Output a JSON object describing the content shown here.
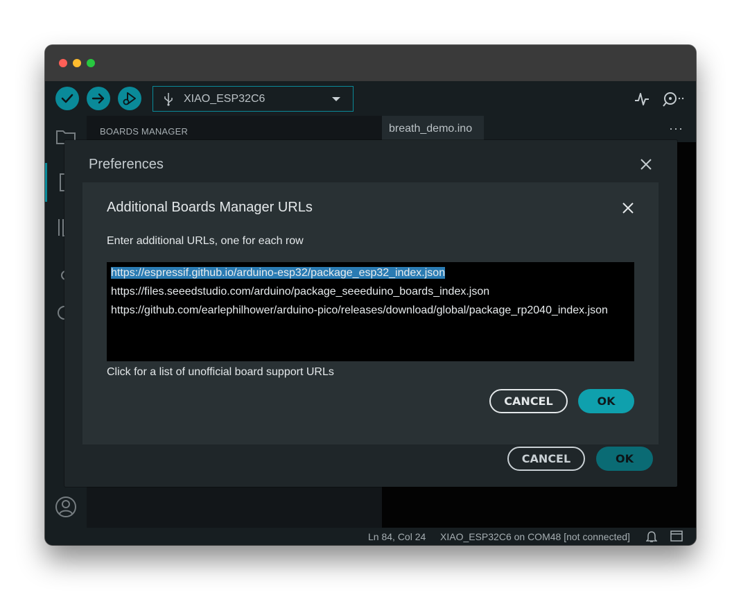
{
  "toolbar": {
    "selected_board": "XIAO_ESP32C6",
    "verify_icon": "check-icon",
    "upload_icon": "arrow-right-icon",
    "debug_icon": "debug-icon",
    "accent": "#0a8a99"
  },
  "sidebar": {
    "title": "BOARDS MANAGER"
  },
  "editor": {
    "tab_label": "breath_demo.ino",
    "more_label": "···"
  },
  "statusbar": {
    "position": "Ln 84, Col 24",
    "board_status": "XIAO_ESP32C6 on COM48 [not connected]"
  },
  "preferences": {
    "title": "Preferences",
    "cancel_label": "CANCEL",
    "ok_label": "OK"
  },
  "urls_dialog": {
    "title": "Additional Boards Manager URLs",
    "description": "Enter additional URLs, one for each row",
    "urls": [
      "https://espressif.github.io/arduino-esp32/package_esp32_index.json",
      "https://files.seeedstudio.com/arduino/package_seeeduino_boards_index.json",
      "https://github.com/earlephilhower/arduino-pico/releases/download/global/package_rp2040_index.json"
    ],
    "link_text": "Click for a list of unofficial board support URLs",
    "cancel_label": "CANCEL",
    "ok_label": "OK",
    "ok_color": "#0fa0ad"
  }
}
